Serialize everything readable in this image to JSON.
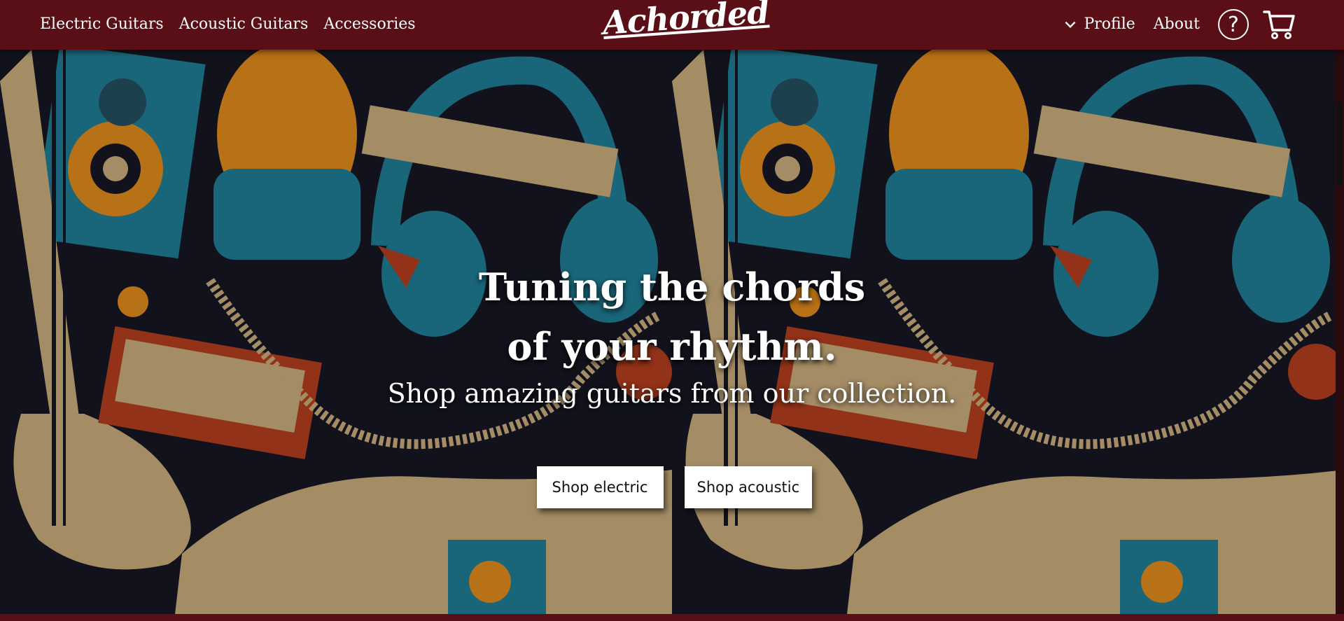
{
  "nav": {
    "left_links": [
      "Electric Guitars",
      "Acoustic Guitars",
      "Accessories"
    ],
    "brand": "Achorded",
    "profile_label": "Profile",
    "about_label": "About",
    "help_label": "?"
  },
  "hero": {
    "headline_line1": "Tuning the chords",
    "headline_line2": "of your rhythm.",
    "subheadline": "Shop amazing guitars from our collection.",
    "buttons": {
      "electric": "Shop electric",
      "acoustic": "Shop acoustic"
    }
  },
  "icons": {
    "chevron": "chevron-down-icon",
    "help": "help-icon",
    "cart": "cart-icon"
  },
  "colors": {
    "nav_bg": "#5a0f16",
    "hero_bg": "#151722",
    "button_bg": "#ffffff"
  }
}
